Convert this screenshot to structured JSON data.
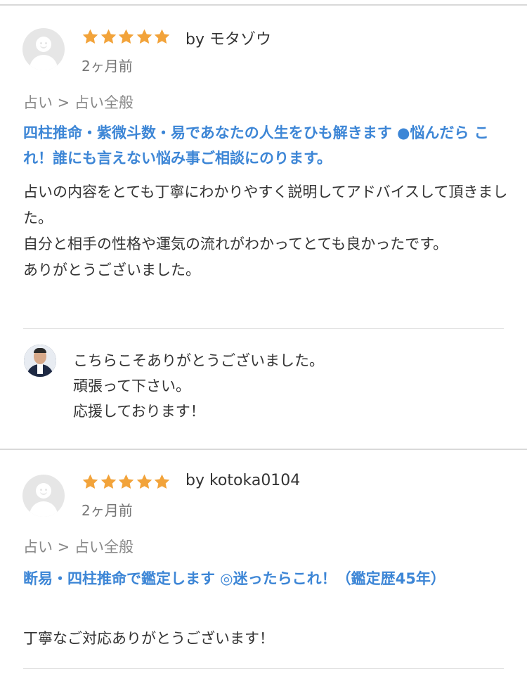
{
  "colors": {
    "star": "#f2a33a",
    "link": "#3d86d6",
    "muted": "#888888",
    "divider": "#d9d9d9"
  },
  "icons": {
    "avatar": "default-user-avatar-icon",
    "star": "star-icon"
  },
  "reviews": [
    {
      "rating": 5,
      "author": "by モタゾウ",
      "date": "2ヶ月前",
      "category": "占い > 占い全般",
      "title": "四柱推命・紫微斗数・易であなたの人生をひも解きます ●悩んだら これ！誰にも言えない悩み事ご相談にのります。",
      "body": "占いの内容をとても丁寧にわかりやすく説明してアドバイスして頂きました。\n自分と相手の性格や運気の流れがわかってとても良かったです。\nありがとうございました。",
      "reply": "こちらこそありがとうございました。\n頑張って下さい。\n応援しております！"
    },
    {
      "rating": 5,
      "author": "by kotoka0104",
      "date": "2ヶ月前",
      "category": "占い > 占い全般",
      "title": "断易・四柱推命で鑑定します ◎迷ったらこれ！（鑑定歴45年）",
      "body": "丁寧なご対応ありがとうございます！"
    }
  ]
}
